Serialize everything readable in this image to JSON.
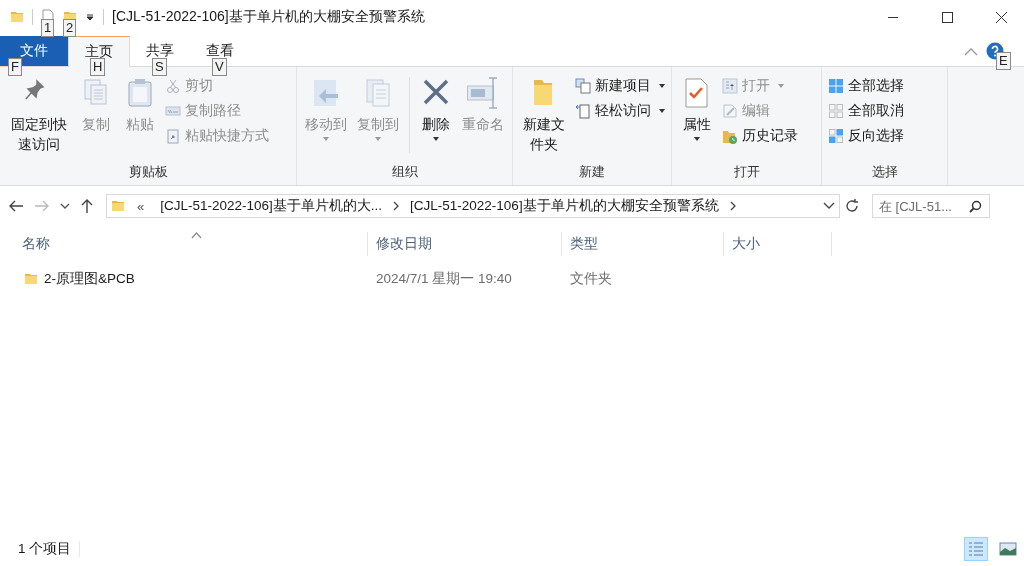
{
  "title_bar": {
    "quick_access_keytips": [
      "1",
      "2"
    ],
    "title": "[CJL-51-2022-106]基于单片机的大棚安全预警系统"
  },
  "ribbon_tabs": [
    {
      "kind": "file",
      "label": "文件",
      "keytip": "F",
      "selected": false
    },
    {
      "kind": "tab",
      "label": "主页",
      "keytip": "H",
      "selected": true
    },
    {
      "kind": "tab",
      "label": "共享",
      "keytip": "S",
      "selected": false
    },
    {
      "kind": "tab",
      "label": "查看",
      "keytip": "V",
      "selected": false
    }
  ],
  "help_keytip": "E",
  "ribbon_groups": [
    {
      "label": "剪贴板",
      "items": [
        {
          "kind": "large",
          "label": "固定到快速访问",
          "disabled": false,
          "dropdown": false
        },
        {
          "kind": "large",
          "label": "复制",
          "disabled": true,
          "dropdown": false
        },
        {
          "kind": "large",
          "label": "粘贴",
          "disabled": true,
          "dropdown": false
        },
        {
          "kind": "stack",
          "buttons": [
            {
              "label": "剪切",
              "disabled": true,
              "dropdown": false
            },
            {
              "label": "复制路径",
              "disabled": true,
              "dropdown": false
            },
            {
              "label": "粘贴快捷方式",
              "disabled": true,
              "dropdown": false
            }
          ]
        }
      ]
    },
    {
      "label": "组织",
      "items": [
        {
          "kind": "large",
          "label": "移动到",
          "disabled": true,
          "dropdown": true
        },
        {
          "kind": "large",
          "label": "复制到",
          "disabled": true,
          "dropdown": true
        },
        {
          "kind": "separator"
        },
        {
          "kind": "large",
          "label": "删除",
          "disabled": false,
          "dropdown": true
        },
        {
          "kind": "large",
          "label": "重命名",
          "disabled": true,
          "dropdown": false
        }
      ]
    },
    {
      "label": "新建",
      "items": [
        {
          "kind": "large",
          "label": "新建文件夹",
          "disabled": false,
          "dropdown": false
        },
        {
          "kind": "stack",
          "buttons": [
            {
              "label": "新建项目",
              "disabled": false,
              "dropdown": true
            },
            {
              "label": "轻松访问",
              "disabled": false,
              "dropdown": true
            }
          ]
        }
      ]
    },
    {
      "label": "打开",
      "items": [
        {
          "kind": "large",
          "label": "属性",
          "disabled": false,
          "dropdown": true
        },
        {
          "kind": "stack",
          "buttons": [
            {
              "label": "打开",
              "disabled": true,
              "dropdown": true
            },
            {
              "label": "编辑",
              "disabled": true,
              "dropdown": false
            },
            {
              "label": "历史记录",
              "disabled": false,
              "dropdown": false
            }
          ]
        }
      ]
    },
    {
      "label": "选择",
      "items": [
        {
          "kind": "stack",
          "buttons": [
            {
              "label": "全部选择",
              "disabled": false,
              "dropdown": false
            },
            {
              "label": "全部取消",
              "disabled": false,
              "dropdown": false
            },
            {
              "label": "反向选择",
              "disabled": false,
              "dropdown": false
            }
          ]
        }
      ]
    }
  ],
  "address_bar": {
    "overflow": "«",
    "segments": [
      "[CJL-51-2022-106]基于单片机的大...",
      "[CJL-51-2022-106]基于单片机的大棚安全预警系统"
    ]
  },
  "search": {
    "placeholder": "在 [CJL-51..."
  },
  "file_list": {
    "columns": [
      {
        "label": "名称",
        "sorted": true
      },
      {
        "label": "修改日期",
        "sorted": false
      },
      {
        "label": "类型",
        "sorted": false
      },
      {
        "label": "大小",
        "sorted": false
      }
    ],
    "rows": [
      {
        "name": "2-原理图&PCB",
        "modified": "2024/7/1 星期一 19:40",
        "type": "文件夹"
      }
    ]
  },
  "status_bar": {
    "item_count": "1 个项目",
    "views": [
      {
        "kind": "details",
        "selected": true
      },
      {
        "kind": "large_icons",
        "selected": false
      }
    ]
  }
}
